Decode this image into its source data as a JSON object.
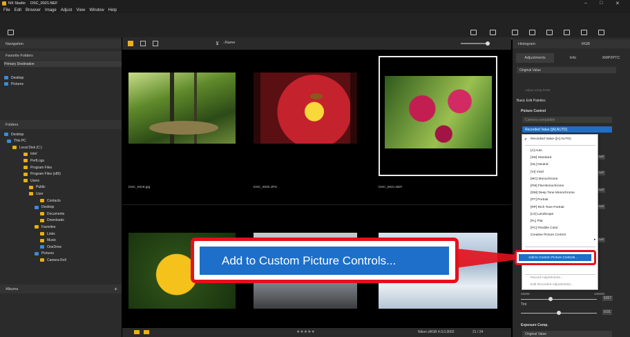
{
  "window": {
    "app": "NX Studio",
    "file": "DSC_0021.NEF",
    "controls": [
      "–",
      "□",
      "✕"
    ]
  },
  "menu": [
    "File",
    "Edit",
    "Browser",
    "Image",
    "Adjust",
    "View",
    "Window",
    "Help"
  ],
  "toolbar": {
    "import": "Import",
    "right": [
      "Custom Picture Control",
      "Pixel shift merge",
      "Edit Video",
      "Other Apps",
      "Slideshow",
      "Print",
      "Upload",
      "Export"
    ]
  },
  "left": {
    "navigation": "Navigation",
    "favorites": "Favorite Folders",
    "primary": "Primary Destination",
    "fav_items": [
      "Desktop",
      "Pictures"
    ],
    "folders": "Folders",
    "tree": [
      "Desktop",
      "This PC",
      "Local Disk (C:)",
      "Intel",
      "PerfLogs",
      "Program Files",
      "Program Files (x86)",
      "Users",
      "Public",
      "User",
      "Contacts",
      "Desktop",
      "Documents",
      "Downloads",
      "Favorites",
      "Links",
      "Music",
      "OneDrive",
      "Pictures",
      "Camera Roll"
    ],
    "albums": "Albums"
  },
  "center": {
    "sort": "Name",
    "captions": [
      "DSC_0019.jpg",
      "DSC_0020.JPG",
      "DSC_0021.NEF"
    ],
    "rating": "★★★★★",
    "profile": "Nikon sRGB 4.0.0.3002",
    "page": "21 / 24"
  },
  "right": {
    "histogram": "Histogram",
    "channel": "RGB",
    "tabs": [
      "Adjustments",
      "Info",
      "XMP/IPTC"
    ],
    "original": "Original Value",
    "adjust_raw": "Adjust using RAW",
    "basic": "Basic Edit Palettes",
    "pc": "Picture Control",
    "camera_compat": "Camera compatible",
    "recorded": "Recorded Value ([A] AUTO)",
    "tint": "Tint",
    "temp_lo": "2500K",
    "temp_hi": "10000K",
    "temp_val": "5207",
    "tint_val": "0.01",
    "exposure": "Exposure Comp.",
    "exposure_val": "Original Value",
    "spin_vals": [
      "4±0",
      "4±0",
      "4±0",
      "4±0",
      "4±0"
    ]
  },
  "dropdown": {
    "checked": "Recorded Value ([A] AUTO)",
    "items": [
      "[A] Auto",
      "[SD] Standard",
      "[NL] Neutral",
      "[VI] Vivid",
      "[MC] Monochrome",
      "[FM] Flat Monochrome",
      "[DM] Deep Tone Monochrome",
      "[PT] Portrait",
      "[RP] Rich Tone Portrait",
      "[LS] Landscape",
      "[FL] Flat",
      "[FC] Flexible Color",
      "Creative Picture Control"
    ],
    "add": "Add to Custom Picture Controls...",
    "record": "Record Adjustments...",
    "edit_record": "Edit Recorded Adjustments..."
  },
  "callout": "Add to Custom Picture Controls..."
}
